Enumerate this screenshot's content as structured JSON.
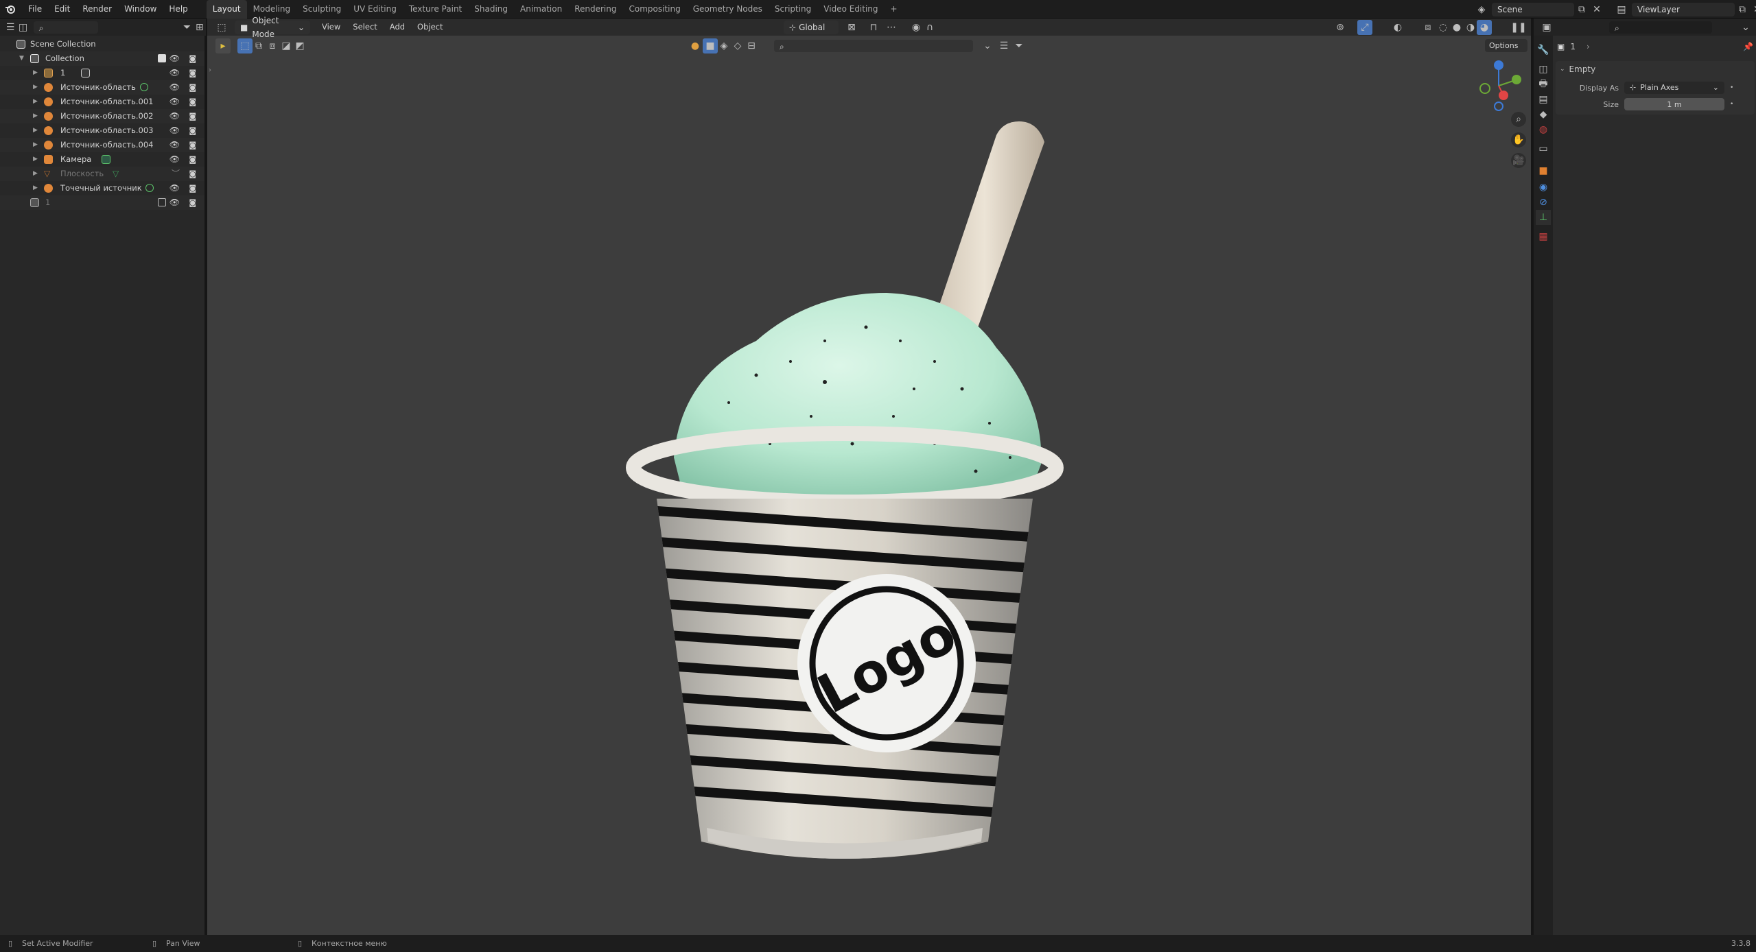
{
  "topbar": {
    "menus": [
      "File",
      "Edit",
      "Render",
      "Window",
      "Help"
    ],
    "workspaces": [
      "Layout",
      "Modeling",
      "Sculpting",
      "UV Editing",
      "Texture Paint",
      "Shading",
      "Animation",
      "Rendering",
      "Compositing",
      "Geometry Nodes",
      "Scripting",
      "Video Editing"
    ],
    "active_workspace": "Layout",
    "add_workspace": "+",
    "scene": "Scene",
    "view_layer": "ViewLayer"
  },
  "outliner": {
    "search_placeholder": "",
    "rows": [
      {
        "label": "Scene Collection",
        "type": "scene",
        "indent": 0
      },
      {
        "label": "Collection",
        "type": "collection",
        "indent": 1
      },
      {
        "label": "1",
        "type": "empty",
        "indent": 2
      },
      {
        "label": "Источник-область",
        "type": "light",
        "indent": 2
      },
      {
        "label": "Источник-область.001",
        "type": "light",
        "indent": 2
      },
      {
        "label": "Источник-область.002",
        "type": "light",
        "indent": 2
      },
      {
        "label": "Источник-область.003",
        "type": "light",
        "indent": 2
      },
      {
        "label": "Источник-область.004",
        "type": "light",
        "indent": 2
      },
      {
        "label": "Камера",
        "type": "camera",
        "indent": 2
      },
      {
        "label": "Плоскость",
        "type": "mesh",
        "indent": 2,
        "dim": true
      },
      {
        "label": "Точечный источник",
        "type": "light",
        "indent": 2
      },
      {
        "label": "1",
        "type": "collection",
        "indent": 1,
        "dim": true
      }
    ]
  },
  "viewport": {
    "mode": "Object Mode",
    "menus": [
      "View",
      "Select",
      "Add",
      "Object"
    ],
    "transform_orientation": "Global",
    "options_label": "Options",
    "search_placeholder": "",
    "gizmo": {
      "x": "X",
      "y": "Y",
      "z": "Z"
    },
    "logo_text": "Logo"
  },
  "properties": {
    "object_name": "1",
    "panel_title": "Empty",
    "display_as_label": "Display As",
    "display_as_value": "Plain Axes",
    "size_label": "Size",
    "size_value": "1 m"
  },
  "statusbar": {
    "left": "Set Active Modifier",
    "middle": "Pan View",
    "right": "Контекстное меню",
    "version": "3.3.8"
  },
  "colors": {
    "accent": "#4772b3",
    "active_tab": "#303030",
    "viewport_bg": "#3d3d3d",
    "light_icon": "#e0873a",
    "collection_icon": "#e0e0e0"
  }
}
